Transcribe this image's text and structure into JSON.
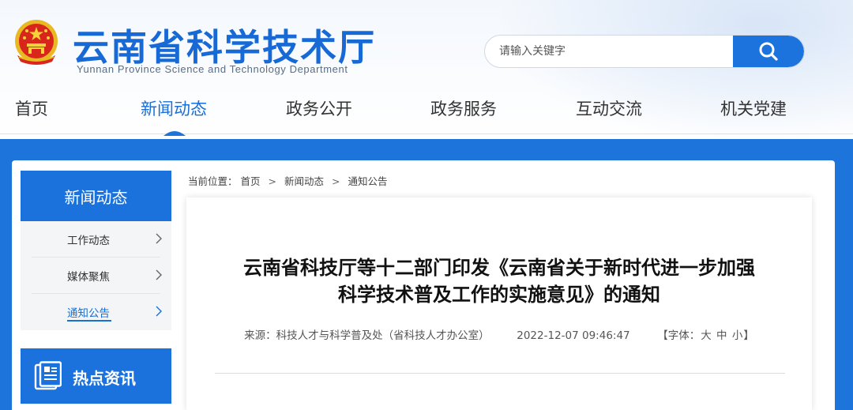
{
  "header": {
    "title": "云南省科学技术厅",
    "subtitle": "Yunnan Province Science and Technology Department",
    "emblem_icon": "national-emblem-icon",
    "search": {
      "placeholder": "请输入关键字",
      "button_icon": "search-icon"
    }
  },
  "nav": {
    "items": [
      {
        "label": "首页"
      },
      {
        "label": "新闻动态",
        "active": true
      },
      {
        "label": "政务公开"
      },
      {
        "label": "政务服务"
      },
      {
        "label": "互动交流"
      },
      {
        "label": "机关党建"
      }
    ]
  },
  "sidebar": {
    "heading": "新闻动态",
    "items": [
      {
        "label": "工作动态"
      },
      {
        "label": "媒体聚焦"
      },
      {
        "label": "通知公告",
        "active": true
      }
    ],
    "hot": {
      "label": "热点资讯",
      "icon": "news-icon"
    }
  },
  "breadcrumb": {
    "prefix": "当前位置：",
    "items": [
      "首页",
      "新闻动态",
      "通知公告"
    ],
    "separator": ">"
  },
  "article": {
    "title_line1": "云南省科技厅等十二部门印发《云南省关于新时代进一步加强",
    "title_line2": "科学技术普及工作的实施意见》的通知",
    "source": "来源：科技人才与科学普及处（省科技人才办公室）",
    "datetime": "2022-12-07 09:46:47",
    "font_prefix": "【字体：",
    "font_large": "大",
    "font_medium": "中",
    "font_small": "小",
    "font_suffix": "】"
  },
  "colors": {
    "primary": "#1c72dc",
    "title": "#1769d6",
    "active_nav": "#1a6fd6"
  }
}
